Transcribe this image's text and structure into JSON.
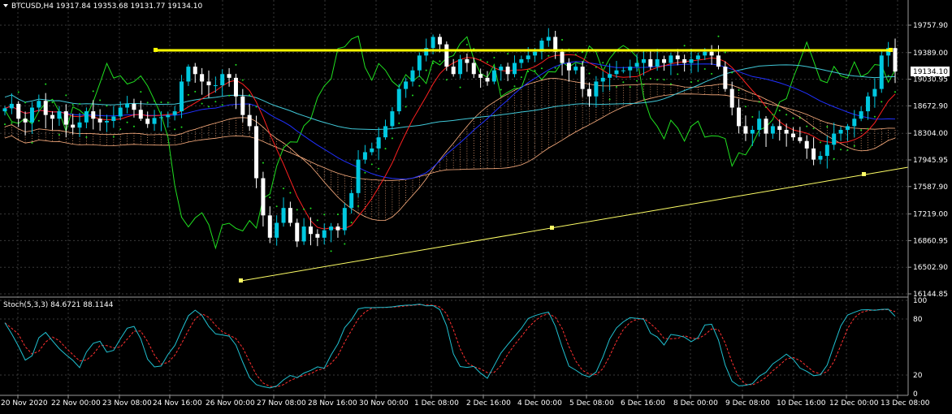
{
  "header": {
    "symbol_line": "BTCUSD,H4  19317.84 19353.68 19131.77 19134.10"
  },
  "stoch_header": "Stoch(5,3,3) 84.6721 88.1144",
  "price_label": "19134.10",
  "colors": {
    "background": "#000000",
    "grid": "#3a3a3a",
    "bull_candle": "#00c8e0",
    "bear_candle": "#ffffff",
    "resistance": "#ffff00",
    "support": "#ffff66",
    "ma_red": "#ff2020",
    "ma_blue": "#2030ff",
    "ma_green": "#20e020",
    "cloud": "#ffb080",
    "stoch_main": "#20c0d0",
    "stoch_signal": "#ff3030"
  },
  "chart_data": {
    "type": "candlestick",
    "symbol": "BTCUSD",
    "timeframe": "H4",
    "last_bar": {
      "open": 19317.84,
      "high": 19353.68,
      "low": 19131.77,
      "close": 19134.1
    },
    "y_ticks": [
      "19757.90",
      "19389.00",
      "19030.95",
      "18672.90",
      "18304.00",
      "17945.95",
      "17587.90",
      "17219.00",
      "16860.95",
      "16502.90",
      "16144.85"
    ],
    "x_ticks": [
      "20 Nov 2020",
      "22 Nov 00:00",
      "23 Nov 08:00",
      "24 Nov 16:00",
      "26 Nov 00:00",
      "27 Nov 08:00",
      "28 Nov 16:00",
      "30 Nov 00:00",
      "1 Dec 08:00",
      "2 Dec 16:00",
      "4 Dec 00:00",
      "5 Dec 08:00",
      "6 Dec 16:00",
      "8 Dec 00:00",
      "9 Dec 08:00",
      "10 Dec 16:00",
      "12 Dec 00:00",
      "13 Dec 08:00"
    ],
    "ylim": [
      16144.85,
      19757.9
    ],
    "closes": [
      18640,
      18700,
      18500,
      18450,
      18650,
      18740,
      18550,
      18500,
      18600,
      18420,
      18380,
      18450,
      18600,
      18500,
      18450,
      18470,
      18530,
      18650,
      18700,
      18620,
      18500,
      18430,
      18510,
      18520,
      18550,
      18600,
      19000,
      19200,
      19100,
      19000,
      18950,
      18950,
      19100,
      19050,
      18800,
      18550,
      18400,
      17700,
      17200,
      16900,
      17100,
      17300,
      17100,
      16850,
      17050,
      16950,
      16900,
      17000,
      17050,
      17000,
      17300,
      17500,
      17950,
      18050,
      18100,
      18250,
      18400,
      18600,
      18900,
      19000,
      19150,
      19350,
      19450,
      19600,
      19500,
      19200,
      19100,
      19300,
      19250,
      19100,
      19050,
      19000,
      19150,
      19200,
      19100,
      19250,
      19300,
      19350,
      19400,
      19550,
      19600,
      19400,
      19250,
      19150,
      19200,
      18900,
      18800,
      19000,
      19050,
      19100,
      19150,
      19150,
      19200,
      19250,
      19300,
      19200,
      19300,
      19250,
      19350,
      19300,
      19250,
      19300,
      19350,
      19400,
      19350,
      19200,
      18900,
      18650,
      18400,
      18300,
      18350,
      18500,
      18300,
      18400,
      18350,
      18300,
      18250,
      18200,
      18100,
      17950,
      18000,
      18150,
      18300,
      18350,
      18400,
      18500,
      18600,
      18800,
      18900,
      19350,
      19450,
      19134.1
    ],
    "resistance_price": 19420,
    "stoch_levels": [
      20,
      80,
      100
    ],
    "stoch_k": [
      84.6721
    ],
    "stoch_d": [
      88.1144
    ]
  }
}
